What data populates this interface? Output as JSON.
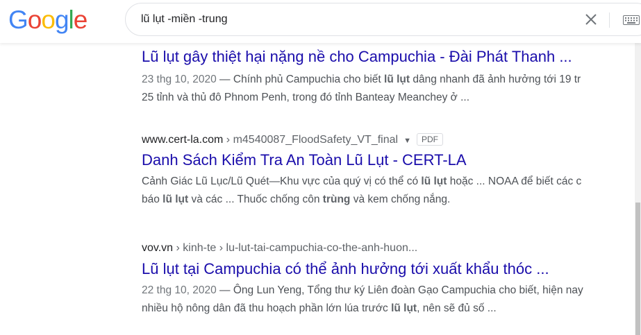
{
  "header": {
    "logo": [
      "G",
      "o",
      "o",
      "g",
      "l",
      "e"
    ],
    "logo_colors": [
      "#4285F4",
      "#EA4335",
      "#FBBC05",
      "#4285F4",
      "#34A853",
      "#EA4335"
    ],
    "search_value": "lũ lụt -miền -trung"
  },
  "results": [
    {
      "title": "Lũ lụt gây thiệt hại nặng nề cho Campuchia - Đài Phát Thanh ...",
      "date": "23 thg 10, 2020",
      "sep": " — ",
      "l1_a": "Chính phủ Campuchia cho biết ",
      "l1_b": "lũ lụt",
      "l1_c": " dâng nhanh đã ảnh hưởng tới 19 tr",
      "l2": "25 tỉnh và thủ đô Phnom Penh, trong đó tỉnh Banteay Meanchey ở ..."
    },
    {
      "site": "www.cert-la.com",
      "path": " › m4540087_FloodSafety_VT_final",
      "badge": "PDF",
      "title": "Danh Sách Kiểm Tra An Toàn Lũ Lụt - CERT-LA",
      "l1_a": "Cảnh Giác Lũ Lục/Lũ Quét—Khu vực của quý vị có thể có ",
      "l1_b": "lũ lụt",
      "l1_c": " hoặc ... NOAA để biết các c",
      "l2_a": "báo ",
      "l2_b": "lũ lụt",
      "l2_c": " và các ... Thuốc chống côn ",
      "l2_d": "trùng",
      "l2_e": " và kem chống nắng."
    },
    {
      "site": "vov.vn",
      "path": " › kinh-te › lu-lut-tai-campuchia-co-the-anh-huon...",
      "title": "Lũ lụt tại Campuchia có thể ảnh hưởng tới xuất khẩu thóc ...",
      "date": "22 thg 10, 2020",
      "sep": " — ",
      "l1": "Ông Lun Yeng, Tổng thư ký Liên đoàn Gạo Campuchia cho biết, hiện nay",
      "l2_a": "nhiều hộ nông dân đã thu hoạch phần lớn lúa trước ",
      "l2_b": "lũ lụt",
      "l2_c": ", nên sẽ đủ số ..."
    }
  ]
}
